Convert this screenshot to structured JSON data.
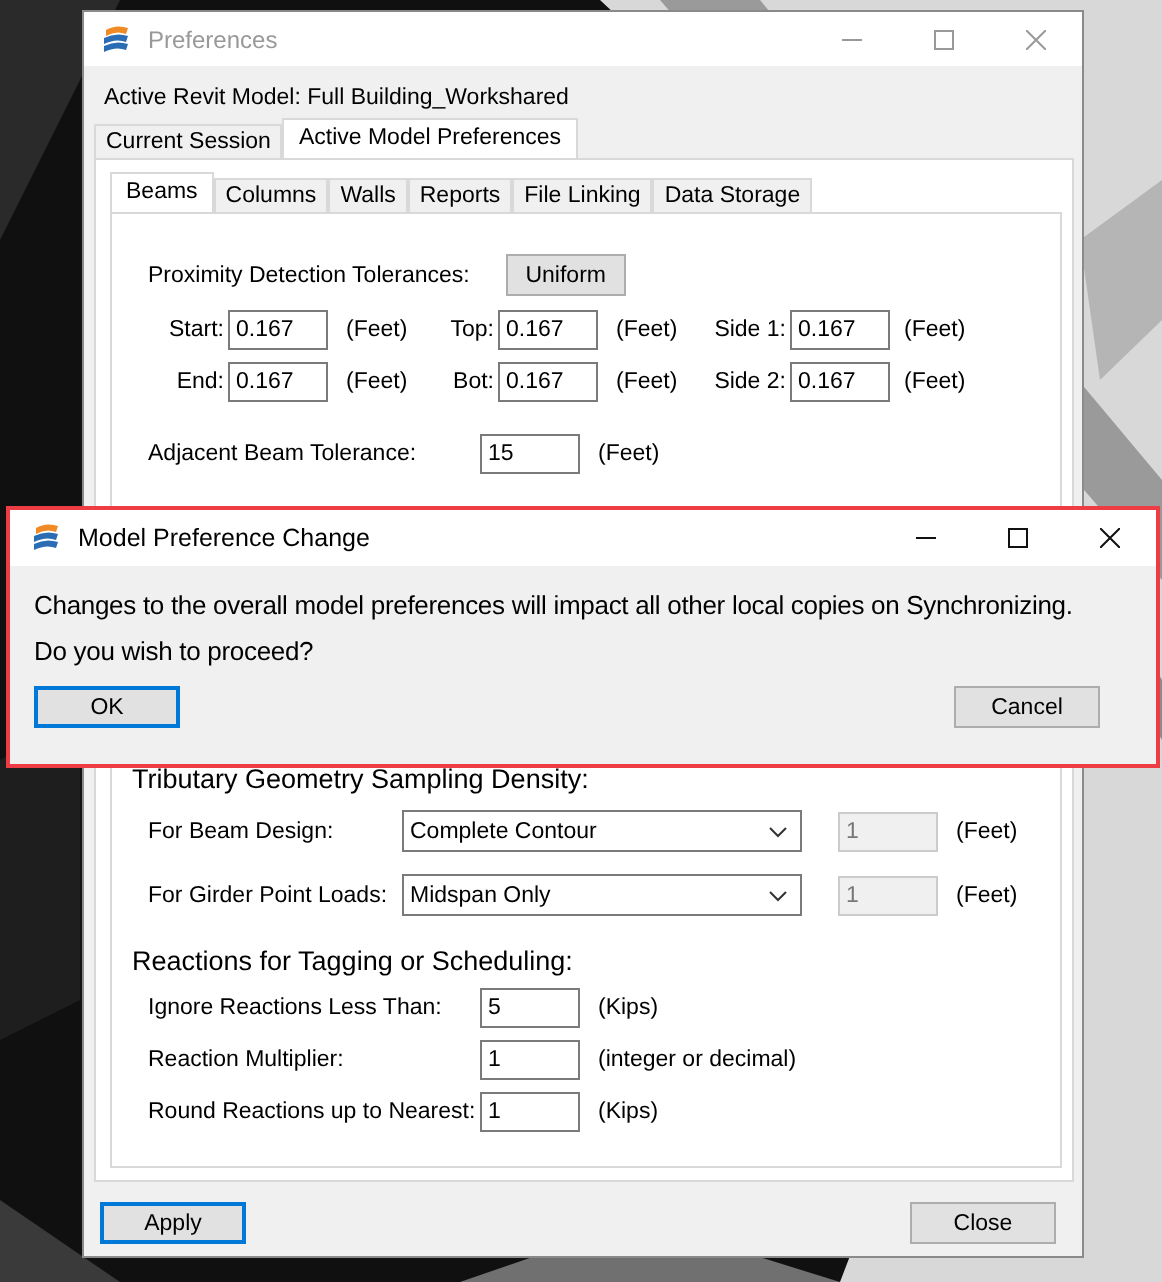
{
  "window": {
    "title": "Preferences",
    "active_model": "Active Revit Model: Full Building_Workshared"
  },
  "tabs": [
    {
      "label": "Current Session",
      "selected": false
    },
    {
      "label": "Active Model Preferences",
      "selected": true
    }
  ],
  "subtabs": [
    {
      "label": "Beams",
      "selected": true
    },
    {
      "label": "Columns",
      "selected": false
    },
    {
      "label": "Walls",
      "selected": false
    },
    {
      "label": "Reports",
      "selected": false
    },
    {
      "label": "File Linking",
      "selected": false
    },
    {
      "label": "Data Storage",
      "selected": false
    }
  ],
  "proximity": {
    "label": "Proximity Detection Tolerances:",
    "button": "Uniform",
    "fields": [
      {
        "label": "Start:",
        "value": "0.167",
        "unit": "(Feet)"
      },
      {
        "label": "Top:",
        "value": "0.167",
        "unit": "(Feet)"
      },
      {
        "label": "Side 1:",
        "value": "0.167",
        "unit": "(Feet)"
      },
      {
        "label": "End:",
        "value": "0.167",
        "unit": "(Feet)"
      },
      {
        "label": "Bot:",
        "value": "0.167",
        "unit": "(Feet)"
      },
      {
        "label": "Side 2:",
        "value": "0.167",
        "unit": "(Feet)"
      }
    ]
  },
  "adjacent": {
    "label": "Adjacent Beam Tolerance:",
    "value": "15",
    "unit": "(Feet)"
  },
  "tributary": {
    "heading": "Tributary Geometry Sampling Density:",
    "rows": [
      {
        "label": "For Beam Design:",
        "choice": "Complete Contour",
        "value": "1",
        "disabled": true,
        "unit": "(Feet)"
      },
      {
        "label": "For Girder Point Loads:",
        "choice": "Midspan Only",
        "value": "1",
        "disabled": true,
        "unit": "(Feet)"
      }
    ]
  },
  "reactions": {
    "heading": "Reactions for Tagging or Scheduling:",
    "rows": [
      {
        "label": "Ignore Reactions Less Than:",
        "value": "5",
        "unit": "(Kips)"
      },
      {
        "label": "Reaction Multiplier:",
        "value": "1",
        "unit": "(integer or decimal)"
      },
      {
        "label": "Round Reactions up to Nearest:",
        "value": "1",
        "unit": "(Kips)"
      }
    ]
  },
  "buttons": [
    {
      "label": "Apply",
      "focused": true
    },
    {
      "label": "Close",
      "focused": false
    }
  ],
  "dialog": {
    "title": "Model Preference Change",
    "message": [
      "Changes to the overall model preferences will impact all other local copies on Synchronizing.",
      "Do you wish to proceed?"
    ],
    "buttons": [
      {
        "label": "OK",
        "focused": true
      },
      {
        "label": "Cancel",
        "focused": false
      }
    ]
  }
}
